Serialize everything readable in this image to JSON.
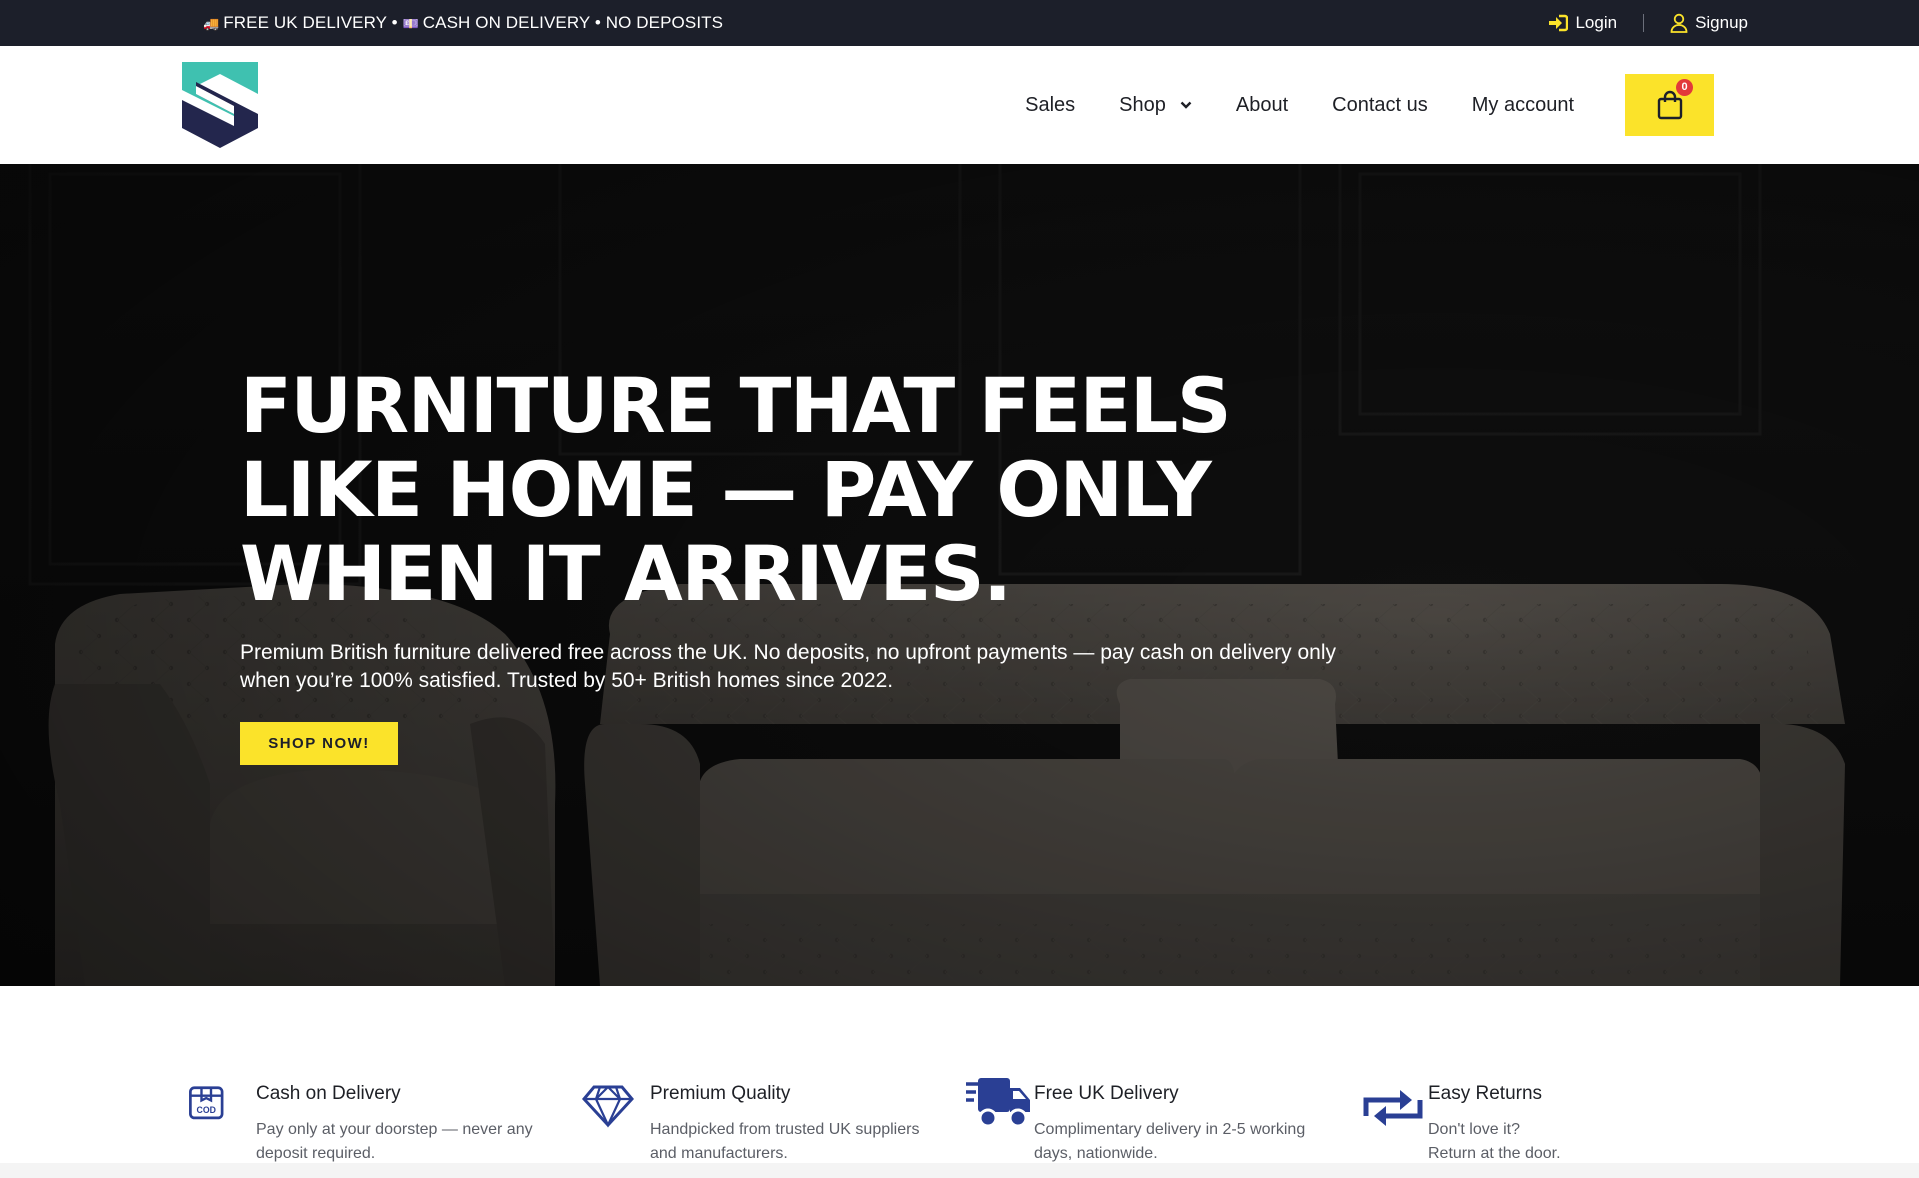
{
  "topbar": {
    "promo_items": [
      "🚚",
      "FREE UK DELIVERY",
      "•",
      "💷",
      "CASH ON DELIVERY",
      "•",
      "NO DEPOSITS"
    ],
    "login_label": "Login",
    "signup_label": "Signup",
    "login_icon": "sign-in-icon",
    "signup_icon": "user-icon"
  },
  "header": {
    "logo": "shield-s-logo",
    "nav": {
      "sales": "Sales",
      "shop": "Shop",
      "about": "About",
      "contact": "Contact us",
      "account": "My account"
    },
    "cart_count": "0",
    "cart_icon": "shopping-bag-icon"
  },
  "hero": {
    "headline": "FURNITURE THAT FEELS LIKE HOME — PAY ONLY WHEN IT ARRIVES.",
    "subtext": "Premium British furniture delivered free across the UK. No deposits, no upfront payments — pay cash on delivery only when you’re 100% satisfied. Trusted by 50+ British homes since 2022.",
    "cta_label": "SHOP NOW!"
  },
  "features": [
    {
      "icon": "cod-box-icon",
      "title": "Cash on Delivery",
      "desc": "Pay only at your doorstep — never any deposit required."
    },
    {
      "icon": "diamond-icon",
      "title": "Premium Quality",
      "desc": "Handpicked from trusted UK suppliers and manufacturers."
    },
    {
      "icon": "delivery-truck-icon",
      "title": "Free UK Delivery",
      "desc": "Complimentary delivery in 2-5 working days, nationwide."
    },
    {
      "icon": "returns-arrows-icon",
      "title": "Easy Returns",
      "desc": "Don't love it?\nReturn at the door."
    }
  ],
  "colors": {
    "topbar_bg": "#1c1f2a",
    "accent_yellow": "#fbe32a",
    "icon_blue": "#2a3f94",
    "badge_red": "#e23a3a",
    "logo_teal": "#3fc1b0",
    "logo_navy": "#23264d"
  }
}
